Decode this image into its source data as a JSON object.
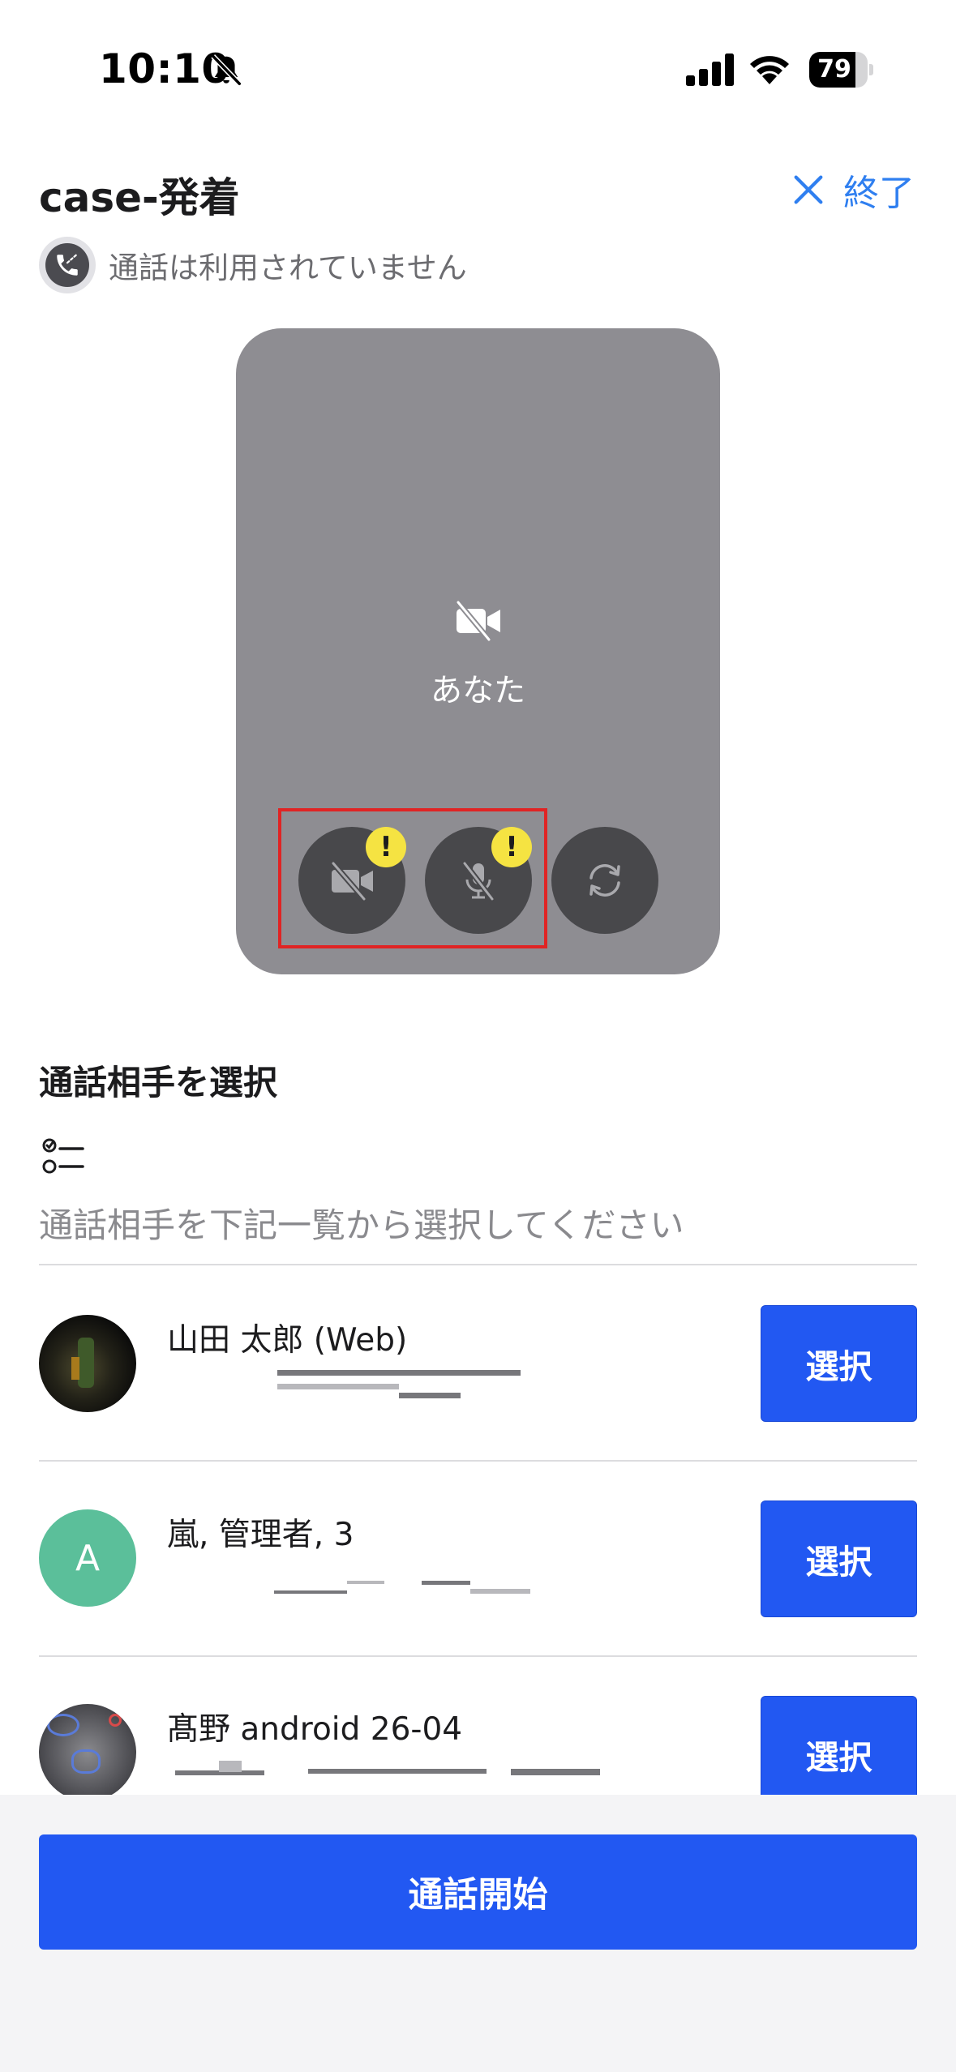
{
  "status_bar": {
    "time": "10:10",
    "battery": "79",
    "battery_level": 0.79
  },
  "header": {
    "title": "case-発着",
    "end_label": "終了",
    "call_status": "通話は利用されていません"
  },
  "preview": {
    "self_label": "あなた",
    "warning_mark": "!"
  },
  "picker": {
    "title": "通話相手を選択",
    "placeholder": "通話相手を下記一覧から選択してください",
    "contacts": [
      {
        "name": "山田 太郎 (Web)",
        "select_label": "選択",
        "avatar": "photo"
      },
      {
        "name": "嵐, 管理者, 3",
        "select_label": "選択",
        "avatar_letter": "A",
        "avatar_color": "#5bbf9a"
      },
      {
        "name": "髙野 android 26-04",
        "select_label": "選択",
        "avatar": "photo"
      }
    ]
  },
  "footer": {
    "start_label": "通話開始"
  },
  "colors": {
    "accent": "#2258f2",
    "link": "#2f7ff0",
    "warning": "#f5e342",
    "highlight": "#e02424"
  }
}
